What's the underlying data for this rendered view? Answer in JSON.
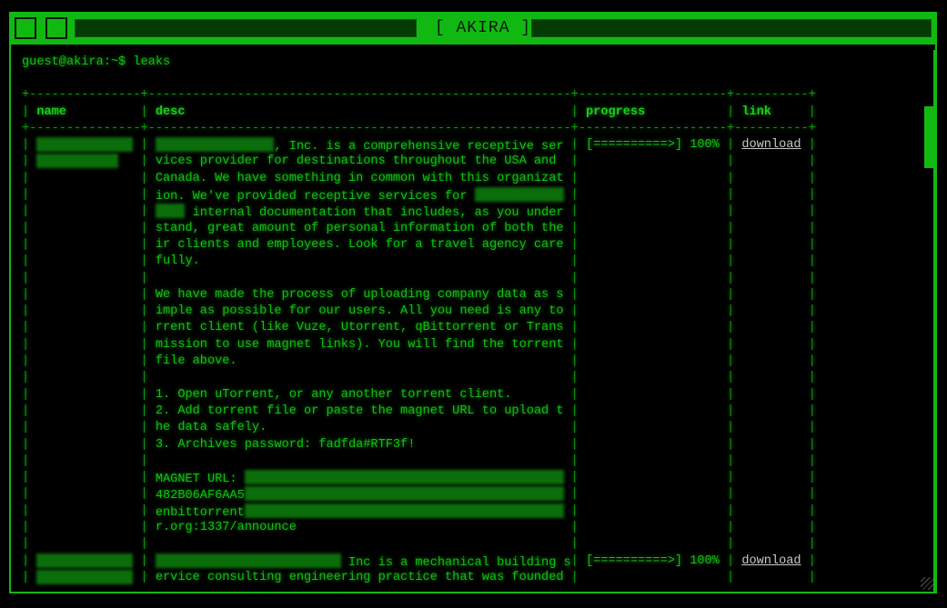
{
  "window": {
    "title": "[ AKIRA ]"
  },
  "terminal": {
    "prompt": "guest@akira:~$ leaks"
  },
  "table": {
    "headers": {
      "name": "name",
      "desc": "desc",
      "progress": "progress",
      "link": "link"
    },
    "rows": [
      {
        "name_lines": [
          [
            {
              "blur": 13
            }
          ],
          [
            {
              "blur": 11
            }
          ]
        ],
        "progress": "[==========>] 100%",
        "progress_value": 100,
        "link": "download",
        "desc_lines": [
          [
            {
              "blur": 16
            },
            {
              "t": ", Inc. is a comprehensive receptive ser"
            }
          ],
          [
            {
              "t": "vices provider for destinations throughout the USA and"
            }
          ],
          [
            {
              "t": "Canada. We have something in common with this organizat"
            }
          ],
          [
            {
              "t": "ion. We've provided receptive services for "
            },
            {
              "blur": 12
            }
          ],
          [
            {
              "blur": 4
            },
            {
              "t": " internal documentation that includes, as you under"
            }
          ],
          [
            {
              "t": "stand, great amount of personal information of both the"
            }
          ],
          [
            {
              "t": "ir clients and employees. Look for a travel agency care"
            }
          ],
          [
            {
              "t": "fully."
            }
          ],
          [],
          [
            {
              "t": "We have made the process of uploading company data as s"
            }
          ],
          [
            {
              "t": "imple as possible for our users. All you need is any to"
            }
          ],
          [
            {
              "t": "rrent client (like Vuze, Utorrent, qBittorrent or Trans"
            }
          ],
          [
            {
              "t": "mission to use magnet links). You will find the torrent"
            }
          ],
          [
            {
              "t": "file above."
            }
          ],
          [],
          [
            {
              "t": "1. Open uTorrent, or any another torrent client."
            }
          ],
          [
            {
              "t": "2. Add torrent file or paste the magnet URL to upload t"
            }
          ],
          [
            {
              "t": "he data safely."
            }
          ],
          [
            {
              "t": "3. Archives password: fadfda#RTF3f!"
            }
          ],
          [],
          [
            {
              "t": "MAGNET URL: "
            },
            {
              "blur": 43
            }
          ],
          [
            {
              "t": "482B06AF6AA5"
            },
            {
              "blur": 43
            }
          ],
          [
            {
              "t": "enbittorrent"
            },
            {
              "blur": 43
            }
          ],
          [
            {
              "t": "r.org:1337/announce"
            }
          ],
          []
        ]
      },
      {
        "name_lines": [
          [
            {
              "blur": 13
            }
          ],
          [
            {
              "blur": 13
            }
          ]
        ],
        "progress": "[==========>] 100%",
        "progress_value": 100,
        "link": "download",
        "desc_lines": [
          [
            {
              "blur": 25
            },
            {
              "t": " Inc is a mechanical building s"
            }
          ],
          [
            {
              "t": "ervice consulting engineering practice that was founded"
            }
          ]
        ]
      }
    ]
  }
}
